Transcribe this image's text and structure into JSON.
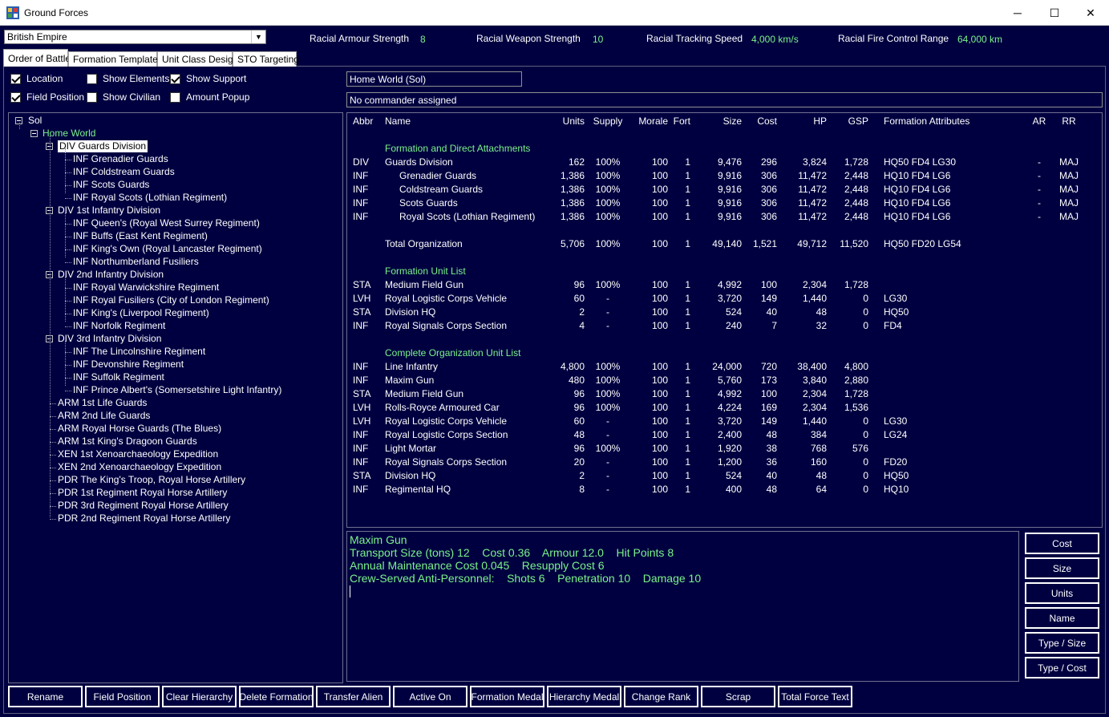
{
  "window": {
    "title": "Ground Forces",
    "minimize": "─",
    "maximize": "☐",
    "close": "✕"
  },
  "empire": {
    "selected": "British Empire"
  },
  "racial": {
    "armour_label": "Racial Armour Strength",
    "armour_value": "8",
    "weapon_label": "Racial Weapon Strength",
    "weapon_value": "10",
    "tracking_label": "Racial Tracking Speed",
    "tracking_value": "4,000 km/s",
    "firecontrol_label": "Racial Fire Control Range",
    "firecontrol_value": "64,000 km"
  },
  "tabs": [
    "Order of Battle",
    "Formation Templates",
    "Unit Class Design",
    "STO Targeting"
  ],
  "checkboxes": [
    {
      "label": "Location",
      "checked": true
    },
    {
      "label": "Show Elements",
      "checked": false
    },
    {
      "label": "Show Support",
      "checked": true
    },
    {
      "label": "Field Position",
      "checked": true
    },
    {
      "label": "Show Civilian",
      "checked": false
    },
    {
      "label": "Amount Popup",
      "checked": false
    }
  ],
  "info": {
    "location": "Home World  (Sol)",
    "commander": "No commander assigned"
  },
  "tree": [
    {
      "label": "Sol",
      "level": 0,
      "expandable": true
    },
    {
      "label": "Home World",
      "level": 1,
      "expandable": true,
      "green": true
    },
    {
      "label": "DIV Guards Division",
      "level": 2,
      "expandable": true,
      "selected": true
    },
    {
      "label": "INF Grenadier Guards",
      "level": 3
    },
    {
      "label": "INF Coldstream Guards",
      "level": 3
    },
    {
      "label": "INF Scots Guards",
      "level": 3
    },
    {
      "label": "INF Royal Scots (Lothian Regiment)",
      "level": 3
    },
    {
      "label": "DIV 1st Infantry Division",
      "level": 2,
      "expandable": true
    },
    {
      "label": "INF Queen's (Royal West Surrey Regiment)",
      "level": 3
    },
    {
      "label": "INF Buffs (East Kent Regiment)",
      "level": 3
    },
    {
      "label": "INF King's Own (Royal Lancaster Regiment)",
      "level": 3
    },
    {
      "label": "INF Northumberland Fusiliers",
      "level": 3
    },
    {
      "label": "DIV 2nd Infantry Division",
      "level": 2,
      "expandable": true
    },
    {
      "label": "INF Royal Warwickshire Regiment",
      "level": 3
    },
    {
      "label": "INF Royal Fusiliers (City of London Regiment)",
      "level": 3
    },
    {
      "label": "INF King's (Liverpool Regiment)",
      "level": 3
    },
    {
      "label": "INF Norfolk Regiment",
      "level": 3
    },
    {
      "label": "DIV 3rd Infantry Division",
      "level": 2,
      "expandable": true
    },
    {
      "label": "INF The Lincolnshire Regiment",
      "level": 3
    },
    {
      "label": "INF Devonshire Regiment",
      "level": 3
    },
    {
      "label": "INF Suffolk Regiment",
      "level": 3
    },
    {
      "label": "INF Prince Albert's (Somersetshire Light Infantry)",
      "level": 3
    },
    {
      "label": "ARM 1st Life Guards",
      "level": 2
    },
    {
      "label": "ARM 2nd Life Guards",
      "level": 2
    },
    {
      "label": "ARM Royal Horse Guards (The Blues)",
      "level": 2
    },
    {
      "label": "ARM 1st King's Dragoon Guards",
      "level": 2
    },
    {
      "label": "XEN 1st Xenoarchaeology Expedition",
      "level": 2
    },
    {
      "label": "XEN 2nd Xenoarchaeology Expedition",
      "level": 2
    },
    {
      "label": "PDR The King's Troop, Royal Horse Artillery",
      "level": 2
    },
    {
      "label": "PDR 1st Regiment Royal Horse Artillery",
      "level": 2
    },
    {
      "label": "PDR 3rd Regiment Royal Horse Artillery",
      "level": 2
    },
    {
      "label": "PDR 2nd Regiment Royal Horse Artillery",
      "level": 2
    }
  ],
  "grid": {
    "columns": [
      "Abbr",
      "Name",
      "Units",
      "Supply",
      "Morale",
      "Fort",
      "Size",
      "Cost",
      "HP",
      "GSP",
      "Formation Attributes",
      "AR",
      "RR"
    ],
    "sections": [
      {
        "heading": "Formation and Direct Attachments",
        "rows": [
          {
            "abbr": "DIV",
            "name": "Guards Division",
            "indent": false,
            "units": "162",
            "supply": "100%",
            "morale": "100",
            "fort": "1",
            "size": "9,476",
            "cost": "296",
            "hp": "3,824",
            "gsp": "1,728",
            "attrs": "HQ50  FD4  LG30",
            "ar": "-",
            "rr": "MAJ"
          },
          {
            "abbr": "INF",
            "name": "Grenadier Guards",
            "indent": true,
            "units": "1,386",
            "supply": "100%",
            "morale": "100",
            "fort": "1",
            "size": "9,916",
            "cost": "306",
            "hp": "11,472",
            "gsp": "2,448",
            "attrs": "HQ10  FD4  LG6",
            "ar": "-",
            "rr": "MAJ"
          },
          {
            "abbr": "INF",
            "name": "Coldstream Guards",
            "indent": true,
            "units": "1,386",
            "supply": "100%",
            "morale": "100",
            "fort": "1",
            "size": "9,916",
            "cost": "306",
            "hp": "11,472",
            "gsp": "2,448",
            "attrs": "HQ10  FD4  LG6",
            "ar": "-",
            "rr": "MAJ"
          },
          {
            "abbr": "INF",
            "name": "Scots Guards",
            "indent": true,
            "units": "1,386",
            "supply": "100%",
            "morale": "100",
            "fort": "1",
            "size": "9,916",
            "cost": "306",
            "hp": "11,472",
            "gsp": "2,448",
            "attrs": "HQ10  FD4  LG6",
            "ar": "-",
            "rr": "MAJ"
          },
          {
            "abbr": "INF",
            "name": "Royal Scots (Lothian Regiment)",
            "indent": true,
            "units": "1,386",
            "supply": "100%",
            "morale": "100",
            "fort": "1",
            "size": "9,916",
            "cost": "306",
            "hp": "11,472",
            "gsp": "2,448",
            "attrs": "HQ10  FD4  LG6",
            "ar": "-",
            "rr": "MAJ"
          },
          {
            "blank": true
          },
          {
            "abbr": "",
            "name": "Total Organization",
            "indent": false,
            "units": "5,706",
            "supply": "100%",
            "morale": "100",
            "fort": "1",
            "size": "49,140",
            "cost": "1,521",
            "hp": "49,712",
            "gsp": "11,520",
            "attrs": "HQ50  FD20  LG54",
            "ar": "",
            "rr": ""
          }
        ]
      },
      {
        "heading": "Formation Unit List",
        "rows": [
          {
            "abbr": "STA",
            "name": "Medium Field Gun",
            "indent": false,
            "units": "96",
            "supply": "100%",
            "morale": "100",
            "fort": "1",
            "size": "4,992",
            "cost": "100",
            "hp": "2,304",
            "gsp": "1,728",
            "attrs": "",
            "ar": "",
            "rr": ""
          },
          {
            "abbr": "LVH",
            "name": "Royal Logistic Corps Vehicle",
            "indent": false,
            "units": "60",
            "supply": "-",
            "morale": "100",
            "fort": "1",
            "size": "3,720",
            "cost": "149",
            "hp": "1,440",
            "gsp": "0",
            "attrs": "LG30",
            "ar": "",
            "rr": ""
          },
          {
            "abbr": "STA",
            "name": "Division HQ",
            "indent": false,
            "units": "2",
            "supply": "-",
            "morale": "100",
            "fort": "1",
            "size": "524",
            "cost": "40",
            "hp": "48",
            "gsp": "0",
            "attrs": "HQ50",
            "ar": "",
            "rr": ""
          },
          {
            "abbr": "INF",
            "name": "Royal Signals Corps Section",
            "indent": false,
            "units": "4",
            "supply": "-",
            "morale": "100",
            "fort": "1",
            "size": "240",
            "cost": "7",
            "hp": "32",
            "gsp": "0",
            "attrs": "FD4",
            "ar": "",
            "rr": ""
          }
        ]
      },
      {
        "heading": "Complete Organization Unit List",
        "rows": [
          {
            "abbr": "INF",
            "name": "Line Infantry",
            "indent": false,
            "units": "4,800",
            "supply": "100%",
            "morale": "100",
            "fort": "1",
            "size": "24,000",
            "cost": "720",
            "hp": "38,400",
            "gsp": "4,800",
            "attrs": "",
            "ar": "",
            "rr": ""
          },
          {
            "abbr": "INF",
            "name": "Maxim Gun",
            "indent": false,
            "units": "480",
            "supply": "100%",
            "morale": "100",
            "fort": "1",
            "size": "5,760",
            "cost": "173",
            "hp": "3,840",
            "gsp": "2,880",
            "attrs": "",
            "ar": "",
            "rr": ""
          },
          {
            "abbr": "STA",
            "name": "Medium Field Gun",
            "indent": false,
            "units": "96",
            "supply": "100%",
            "morale": "100",
            "fort": "1",
            "size": "4,992",
            "cost": "100",
            "hp": "2,304",
            "gsp": "1,728",
            "attrs": "",
            "ar": "",
            "rr": ""
          },
          {
            "abbr": "LVH",
            "name": "Rolls-Royce Armoured Car",
            "indent": false,
            "units": "96",
            "supply": "100%",
            "morale": "100",
            "fort": "1",
            "size": "4,224",
            "cost": "169",
            "hp": "2,304",
            "gsp": "1,536",
            "attrs": "",
            "ar": "",
            "rr": ""
          },
          {
            "abbr": "LVH",
            "name": "Royal Logistic Corps Vehicle",
            "indent": false,
            "units": "60",
            "supply": "-",
            "morale": "100",
            "fort": "1",
            "size": "3,720",
            "cost": "149",
            "hp": "1,440",
            "gsp": "0",
            "attrs": "LG30",
            "ar": "",
            "rr": ""
          },
          {
            "abbr": "INF",
            "name": "Royal Logistic Corps Section",
            "indent": false,
            "units": "48",
            "supply": "-",
            "morale": "100",
            "fort": "1",
            "size": "2,400",
            "cost": "48",
            "hp": "384",
            "gsp": "0",
            "attrs": "LG24",
            "ar": "",
            "rr": ""
          },
          {
            "abbr": "INF",
            "name": "Light Mortar",
            "indent": false,
            "units": "96",
            "supply": "100%",
            "morale": "100",
            "fort": "1",
            "size": "1,920",
            "cost": "38",
            "hp": "768",
            "gsp": "576",
            "attrs": "",
            "ar": "",
            "rr": ""
          },
          {
            "abbr": "INF",
            "name": "Royal Signals Corps Section",
            "indent": false,
            "units": "20",
            "supply": "-",
            "morale": "100",
            "fort": "1",
            "size": "1,200",
            "cost": "36",
            "hp": "160",
            "gsp": "0",
            "attrs": "FD20",
            "ar": "",
            "rr": ""
          },
          {
            "abbr": "STA",
            "name": "Division HQ",
            "indent": false,
            "units": "2",
            "supply": "-",
            "morale": "100",
            "fort": "1",
            "size": "524",
            "cost": "40",
            "hp": "48",
            "gsp": "0",
            "attrs": "HQ50",
            "ar": "",
            "rr": ""
          },
          {
            "abbr": "INF",
            "name": "Regimental HQ",
            "indent": false,
            "units": "8",
            "supply": "-",
            "morale": "100",
            "fort": "1",
            "size": "400",
            "cost": "48",
            "hp": "64",
            "gsp": "0",
            "attrs": "HQ10",
            "ar": "",
            "rr": ""
          }
        ]
      }
    ]
  },
  "detail": {
    "lines": [
      "Maxim Gun",
      "Transport Size (tons) 12    Cost 0.36    Armour 12.0    Hit Points 8",
      "Annual Maintenance Cost 0.045    Resupply Cost 6",
      "Crew-Served Anti-Personnel:    Shots 6    Penetration 10    Damage 10"
    ]
  },
  "sort_buttons": [
    "Cost",
    "Size",
    "Units",
    "Name",
    "Type / Size",
    "Type / Cost"
  ],
  "buttons": [
    "Rename",
    "Field Position",
    "Clear Hierarchy",
    "Delete Formation",
    "Transfer Alien",
    "Active On",
    "Formation Medal",
    "Hierarchy Medal",
    "Change Rank",
    "Scrap",
    "Total Force Text"
  ],
  "colors": {
    "background": "#000040",
    "accent_green": "#7cf28a",
    "text": "#ffffff"
  }
}
